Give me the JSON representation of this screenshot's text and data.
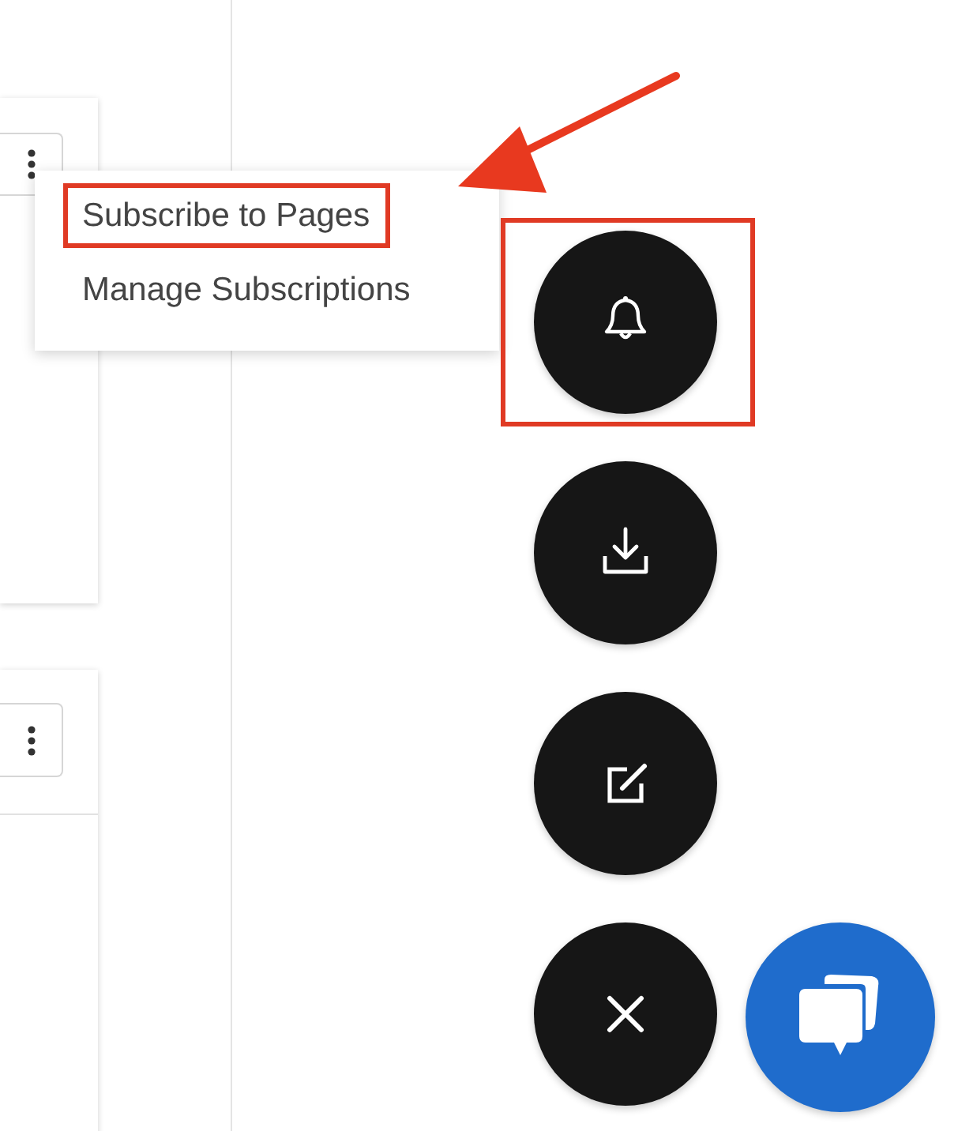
{
  "cards": [
    {
      "kind": "card",
      "rule": false
    },
    {
      "kind": "card",
      "rule": true
    }
  ],
  "menu": {
    "items": [
      {
        "label": "Subscribe to Pages",
        "highlighted": true
      },
      {
        "label": "Manage Subscriptions",
        "highlighted": false
      }
    ]
  },
  "fabs": [
    {
      "kind": "bell",
      "highlighted": true
    },
    {
      "kind": "download",
      "highlighted": false
    },
    {
      "kind": "edit",
      "highlighted": false
    },
    {
      "kind": "close",
      "highlighted": false
    }
  ]
}
